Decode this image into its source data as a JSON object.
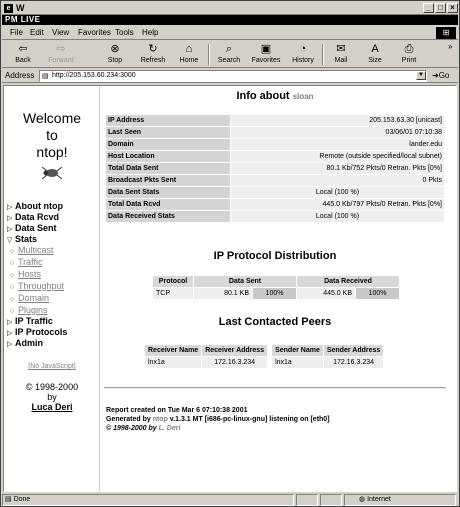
{
  "window": {
    "title": "W",
    "brand": "PM LIVE"
  },
  "menu": [
    "File",
    "Edit",
    "View",
    "Favorites",
    "Tools",
    "Help"
  ],
  "toolbar": {
    "back": "Back",
    "forward": "Forward",
    "stop": "Stop",
    "refresh": "Refresh",
    "home": "Home",
    "search": "Search",
    "favorites": "Favorites",
    "history": "History",
    "mail": "Mail",
    "size": "Size",
    "print": "Print"
  },
  "address": {
    "label": "Address",
    "url": "http://205.153.60.234:3000",
    "go": "Go"
  },
  "nav": {
    "welcome": [
      "Welcome",
      "to",
      "ntop!"
    ],
    "items": {
      "about": "About ntop",
      "rcvd": "Data Rcvd",
      "sent": "Data Sent",
      "stats": "Stats",
      "multicast": "Multicast",
      "traffic": "Traffic",
      "hosts": "Hosts",
      "throughput": "Throughput",
      "domain": "Domain",
      "plugins": "Plugins",
      "iptraffic": "IP Traffic",
      "ipprotocols": "IP Protocols",
      "admin": "Admin"
    },
    "nojs": "[No JavaScript]",
    "copyright": "© 1998-2000",
    "by": "by",
    "author": "Luca Deri"
  },
  "info": {
    "heading": "Info about",
    "host": "sloan",
    "rows": [
      {
        "k": "IP Address",
        "v": "205.153.63.30 [unicast]"
      },
      {
        "k": "Last Seen",
        "v": "03/06/01 07:10:38"
      },
      {
        "k": "Domain",
        "v": "lander.edu"
      },
      {
        "k": "Host Location",
        "v": "Remote (outside specified/local subnet)"
      },
      {
        "k": "Total Data Sent",
        "v": "80.1 Kb/752 Pkts/0 Retran. Pkts [0%]"
      },
      {
        "k": "Broadcast Pkts Sent",
        "v": "0 Pkts"
      },
      {
        "k": "Data Sent Stats",
        "v": "Local (100 %)"
      },
      {
        "k": "Total Data Rcvd",
        "v": "445.0 Kb/797 Pkts/0 Retran. Pkts [0%]"
      },
      {
        "k": "Data Received Stats",
        "v": "Local (100 %)"
      }
    ]
  },
  "protocol": {
    "heading": "IP Protocol Distribution",
    "headers": [
      "Protocol",
      "Data Sent",
      "Data Received"
    ],
    "row": {
      "proto": "TCP",
      "sent": "80.1 KB",
      "sent_pct": "100%",
      "rcvd": "445.0 KB",
      "rcvd_pct": "100%"
    }
  },
  "peers": {
    "heading": "Last Contacted Peers",
    "headers": [
      "Receiver Name",
      "Receiver Address",
      "Sender Name",
      "Sender Address"
    ],
    "row": {
      "rname": "lnx1a",
      "raddr": "172.16.3.234",
      "sname": "lnx1a",
      "saddr": "172.16.3.234"
    }
  },
  "report": {
    "line1": "Report created on Tue Mar 6 07:10:38 2001",
    "line2a": "Generated by ",
    "line2b": "ntop",
    "line2c": " v.1.3.1 MT [i686-pc-linux-gnu] listening on [eth0]",
    "line3a": "© 1998-2000 by ",
    "line3b": "L. Deri"
  },
  "status": {
    "done": "Done",
    "zone": "Internet"
  }
}
